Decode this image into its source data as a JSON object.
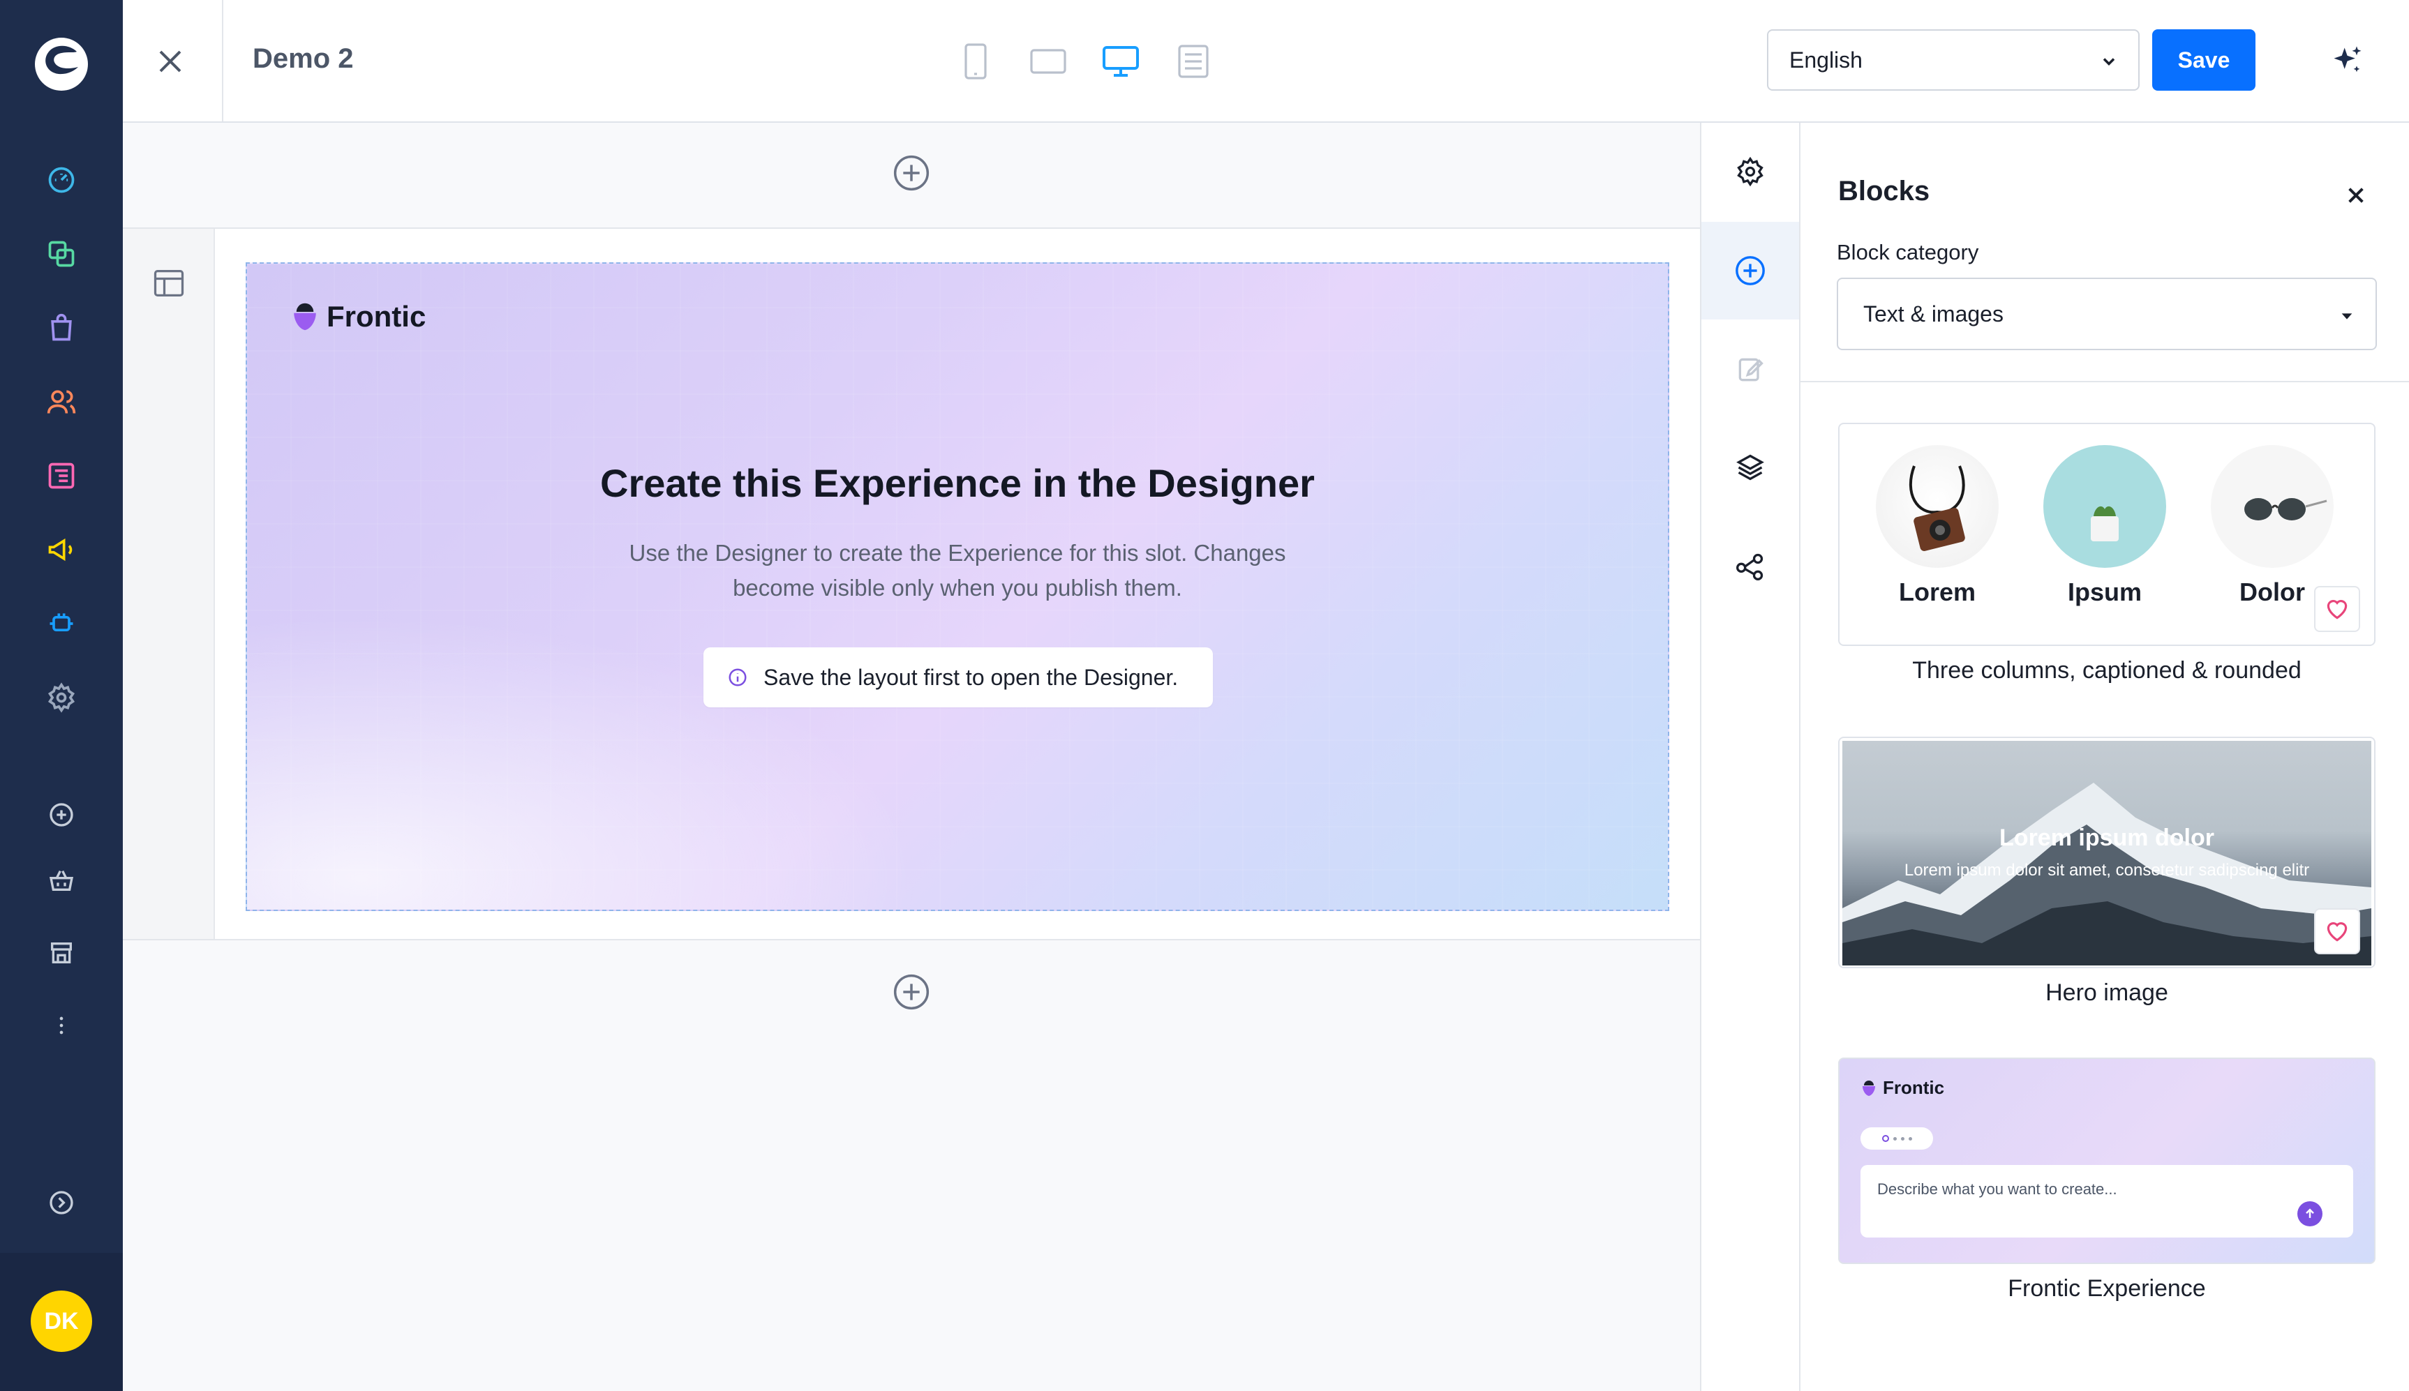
{
  "sidebar": {
    "avatar_initials": "DK",
    "nav_icons": [
      "dashboard-icon",
      "catalogue-icon",
      "orders-icon",
      "customers-icon",
      "content-icon",
      "marketing-icon",
      "extensions-icon",
      "settings-icon",
      "add-icon",
      "sales-channel-icon",
      "storefront-icon",
      "more-icon",
      "expand-icon"
    ]
  },
  "topbar": {
    "title": "Demo 2",
    "language": "English",
    "save_label": "Save"
  },
  "slot": {
    "brand": "Frontic",
    "heading": "Create this Experience in the Designer",
    "description_line1": "Use the Designer to create the Experience for this slot. Changes",
    "description_line2": "become visible only when you publish them.",
    "notice": "Save the layout first to open the Designer."
  },
  "panel": {
    "title": "Blocks",
    "category_label": "Block category",
    "category_value": "Text & images",
    "blocks": [
      {
        "caption": "Three columns, captioned & rounded",
        "columns": [
          "Lorem",
          "Ipsum",
          "Dolor"
        ]
      },
      {
        "caption": "Hero image",
        "hero_title": "Lorem ipsum dolor",
        "hero_subtitle": "Lorem ipsum dolor sit amet, consetetur sadipscing elitr"
      },
      {
        "caption": "Frontic Experience",
        "brand": "Frontic",
        "prompt_placeholder": "Describe what you want to create..."
      }
    ]
  },
  "colors": {
    "sidebar_bg": "#1e2d4c",
    "accent": "#0870ff",
    "avatar": "#ffd500",
    "favorite": "#e8457a"
  }
}
